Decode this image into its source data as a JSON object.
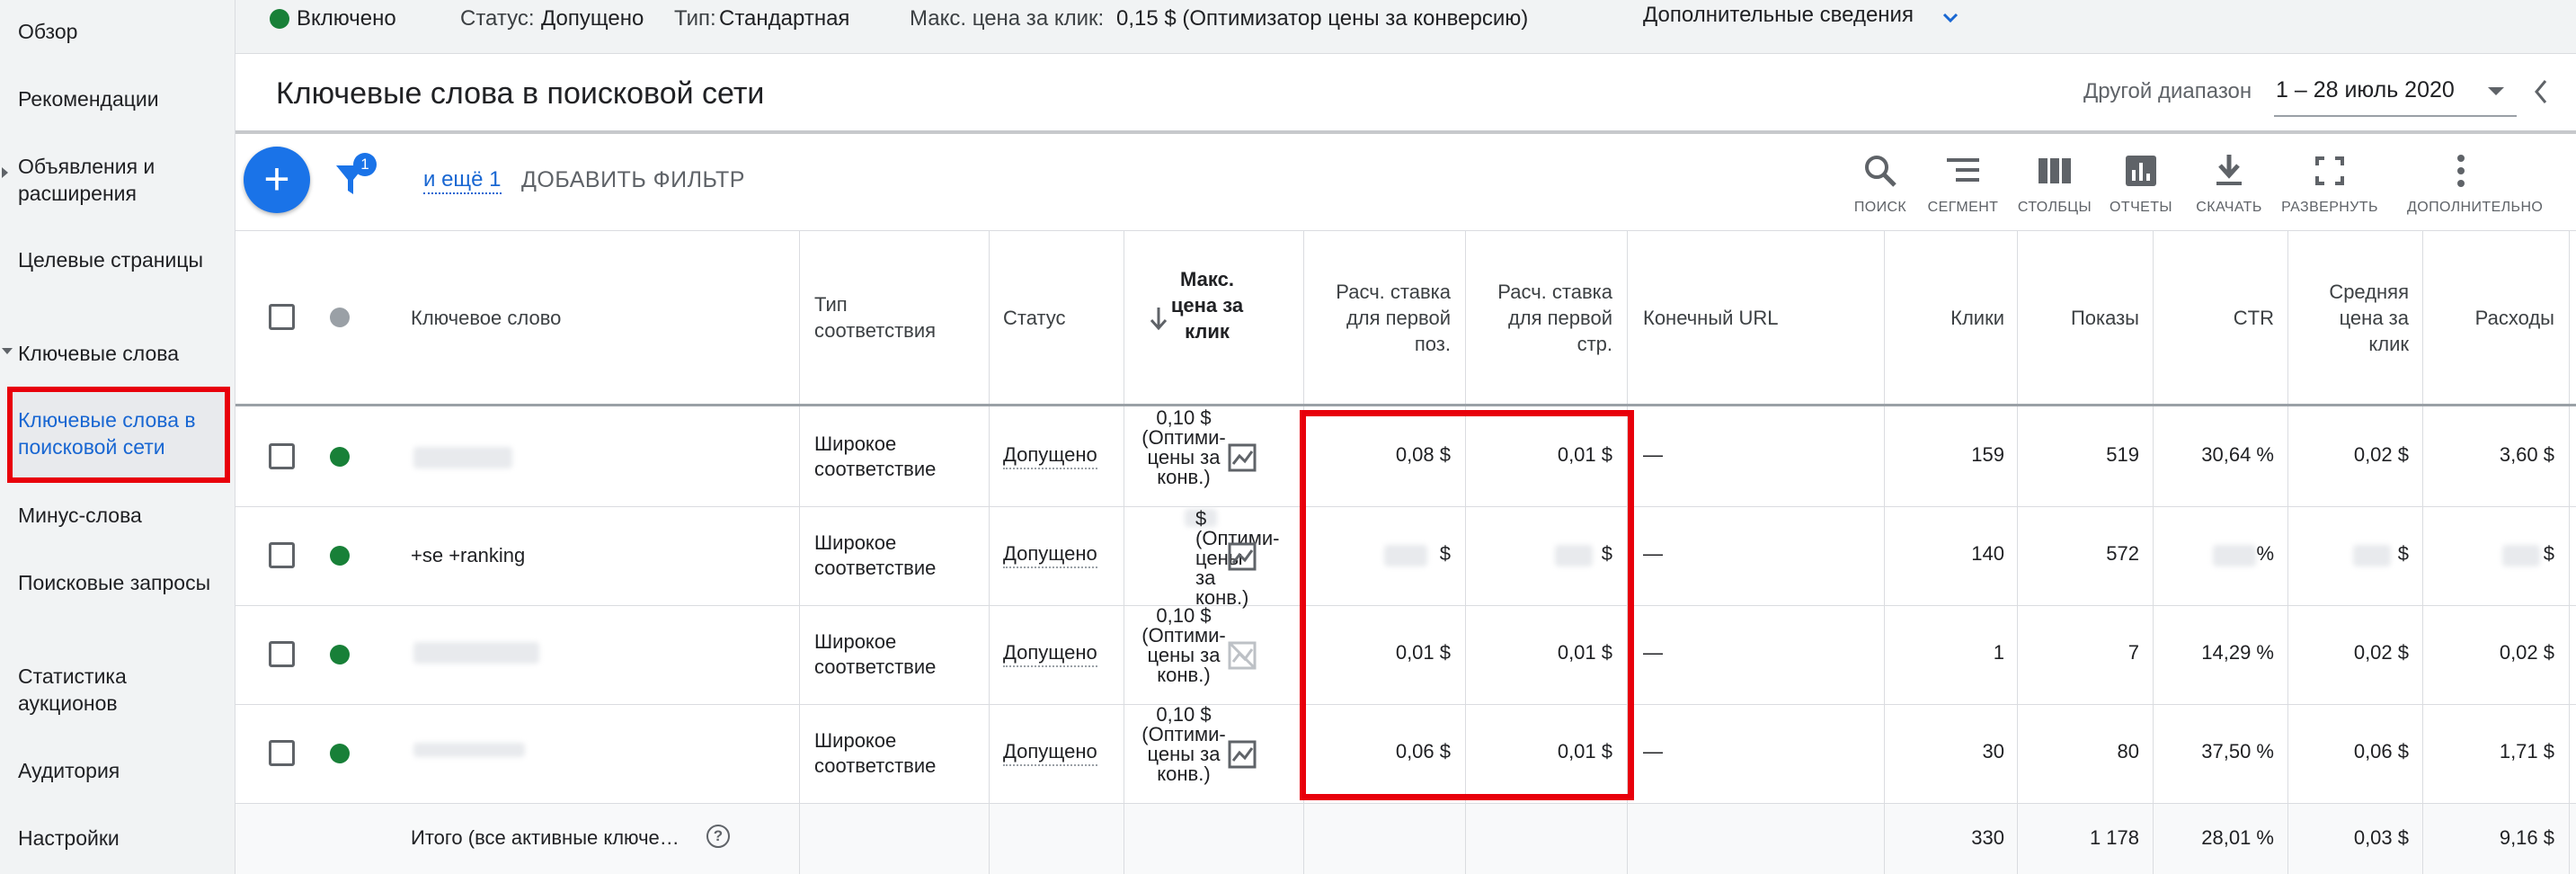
{
  "sidebar": {
    "items": [
      {
        "label": "Обзор"
      },
      {
        "label": "Рекомендации"
      },
      {
        "label": "Объявления и расширения"
      },
      {
        "label": "Целевые страницы"
      },
      {
        "label": "Ключевые слова"
      },
      {
        "label": "Ключевые слова в поисковой сети"
      },
      {
        "label": "Минус-слова"
      },
      {
        "label": "Поисковые запросы"
      },
      {
        "label": "Статистика аукционов"
      },
      {
        "label": "Аудитория"
      },
      {
        "label": "Настройки"
      }
    ]
  },
  "topbar": {
    "status_value": "Включено",
    "status_label": "Статус:",
    "status_text": "Допущено",
    "type_label": "Тип:",
    "type_value": "Стандартная",
    "maxcpc_label": "Макс. цена за клик:",
    "maxcpc_value": "0,15 $ (Оптимизатор цены за конверсию)",
    "details_link": "Дополнительные сведения"
  },
  "header": {
    "title": "Ключевые слова в поисковой сети",
    "range_label": "Другой диапазон",
    "range_value": "1 – 28 июль 2020"
  },
  "toolbar": {
    "add_icon": "+",
    "filter_count": "1",
    "more_filters": "и ещё 1",
    "add_filter": "ДОБАВИТЬ ФИЛЬТР",
    "tools": [
      "ПОИСК",
      "СЕГМЕНТ",
      "СТОЛБЦЫ",
      "ОТЧЕТЫ",
      "СКАЧАТЬ",
      "РАЗВЕРНУТЬ",
      "ДОПОЛНИТЕЛЬНО"
    ]
  },
  "table": {
    "headers": {
      "keyword": "Ключевое слово",
      "match": "Тип соответствия",
      "status": "Статус",
      "maxcpc": "Макс. цена за клик",
      "first_pos": "Расч. ставка для первой поз.",
      "first_page": "Расч. ставка для первой стр.",
      "url": "Конечный URL",
      "clicks": "Клики",
      "impr": "Показы",
      "ctr": "CTR",
      "avg_cpc": "Средняя цена за клик",
      "cost": "Расходы"
    },
    "rows": [
      {
        "keyword": "",
        "match": "Широкое соответствие",
        "status": "Допущено",
        "bid": "0,10 $ (Оптими- цены за конв.)",
        "first_pos": "0,08 $",
        "first_page": "0,01 $",
        "url": "—",
        "clicks": "159",
        "impr": "519",
        "ctr": "30,64 %",
        "avg_cpc": "0,02 $",
        "cost": "3,60 $"
      },
      {
        "keyword": "+se +ranking",
        "match": "Широкое соответствие",
        "status": "Допущено",
        "bid": "$ (Оптими- цены за конв.)",
        "first_pos": "$",
        "first_page": "$",
        "url": "—",
        "clicks": "140",
        "impr": "572",
        "ctr": "%",
        "avg_cpc": "$",
        "cost": "$"
      },
      {
        "keyword": "",
        "match": "Широкое соответствие",
        "status": "Допущено",
        "bid": "0,10 $ (Оптими- цены за конв.)",
        "first_pos": "0,01 $",
        "first_page": "0,01 $",
        "url": "—",
        "clicks": "1",
        "impr": "7",
        "ctr": "14,29 %",
        "avg_cpc": "0,02 $",
        "cost": "0,02 $"
      },
      {
        "keyword": "",
        "match": "Широкое соответствие",
        "status": "Допущено",
        "bid": "0,10 $ (Оптими- цены за конв.)",
        "first_pos": "0,06 $",
        "first_page": "0,01 $",
        "url": "—",
        "clicks": "30",
        "impr": "80",
        "ctr": "37,50 %",
        "avg_cpc": "0,06 $",
        "cost": "1,71 $"
      }
    ],
    "total": {
      "label": "Итого (все активные ключе…",
      "clicks": "330",
      "impr": "1 178",
      "ctr": "28,01 %",
      "avg_cpc": "0,03 $",
      "cost": "9,16 $"
    }
  },
  "colors": {
    "accent": "#1a73e8",
    "status_green": "#188038",
    "highlight_red": "#e8000b"
  }
}
